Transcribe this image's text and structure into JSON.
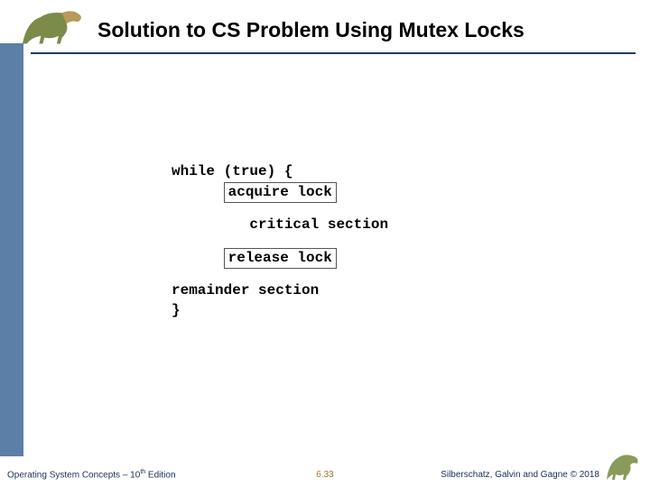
{
  "title": "Solution to CS Problem Using Mutex Locks",
  "code": {
    "line1": "while (true) {",
    "acquire": "acquire lock",
    "critical": "critical section",
    "release": "release lock",
    "remainder": "remainder section",
    "close": "}"
  },
  "footer": {
    "left_prefix": "Operating System Concepts – 10",
    "left_suffix": " Edition",
    "left_super": "th",
    "center": "6.33",
    "right": "Silberschatz, Galvin and Gagne © 2018"
  },
  "colors": {
    "sidebar": "#5b7fa6",
    "rule": "#243a5e"
  }
}
